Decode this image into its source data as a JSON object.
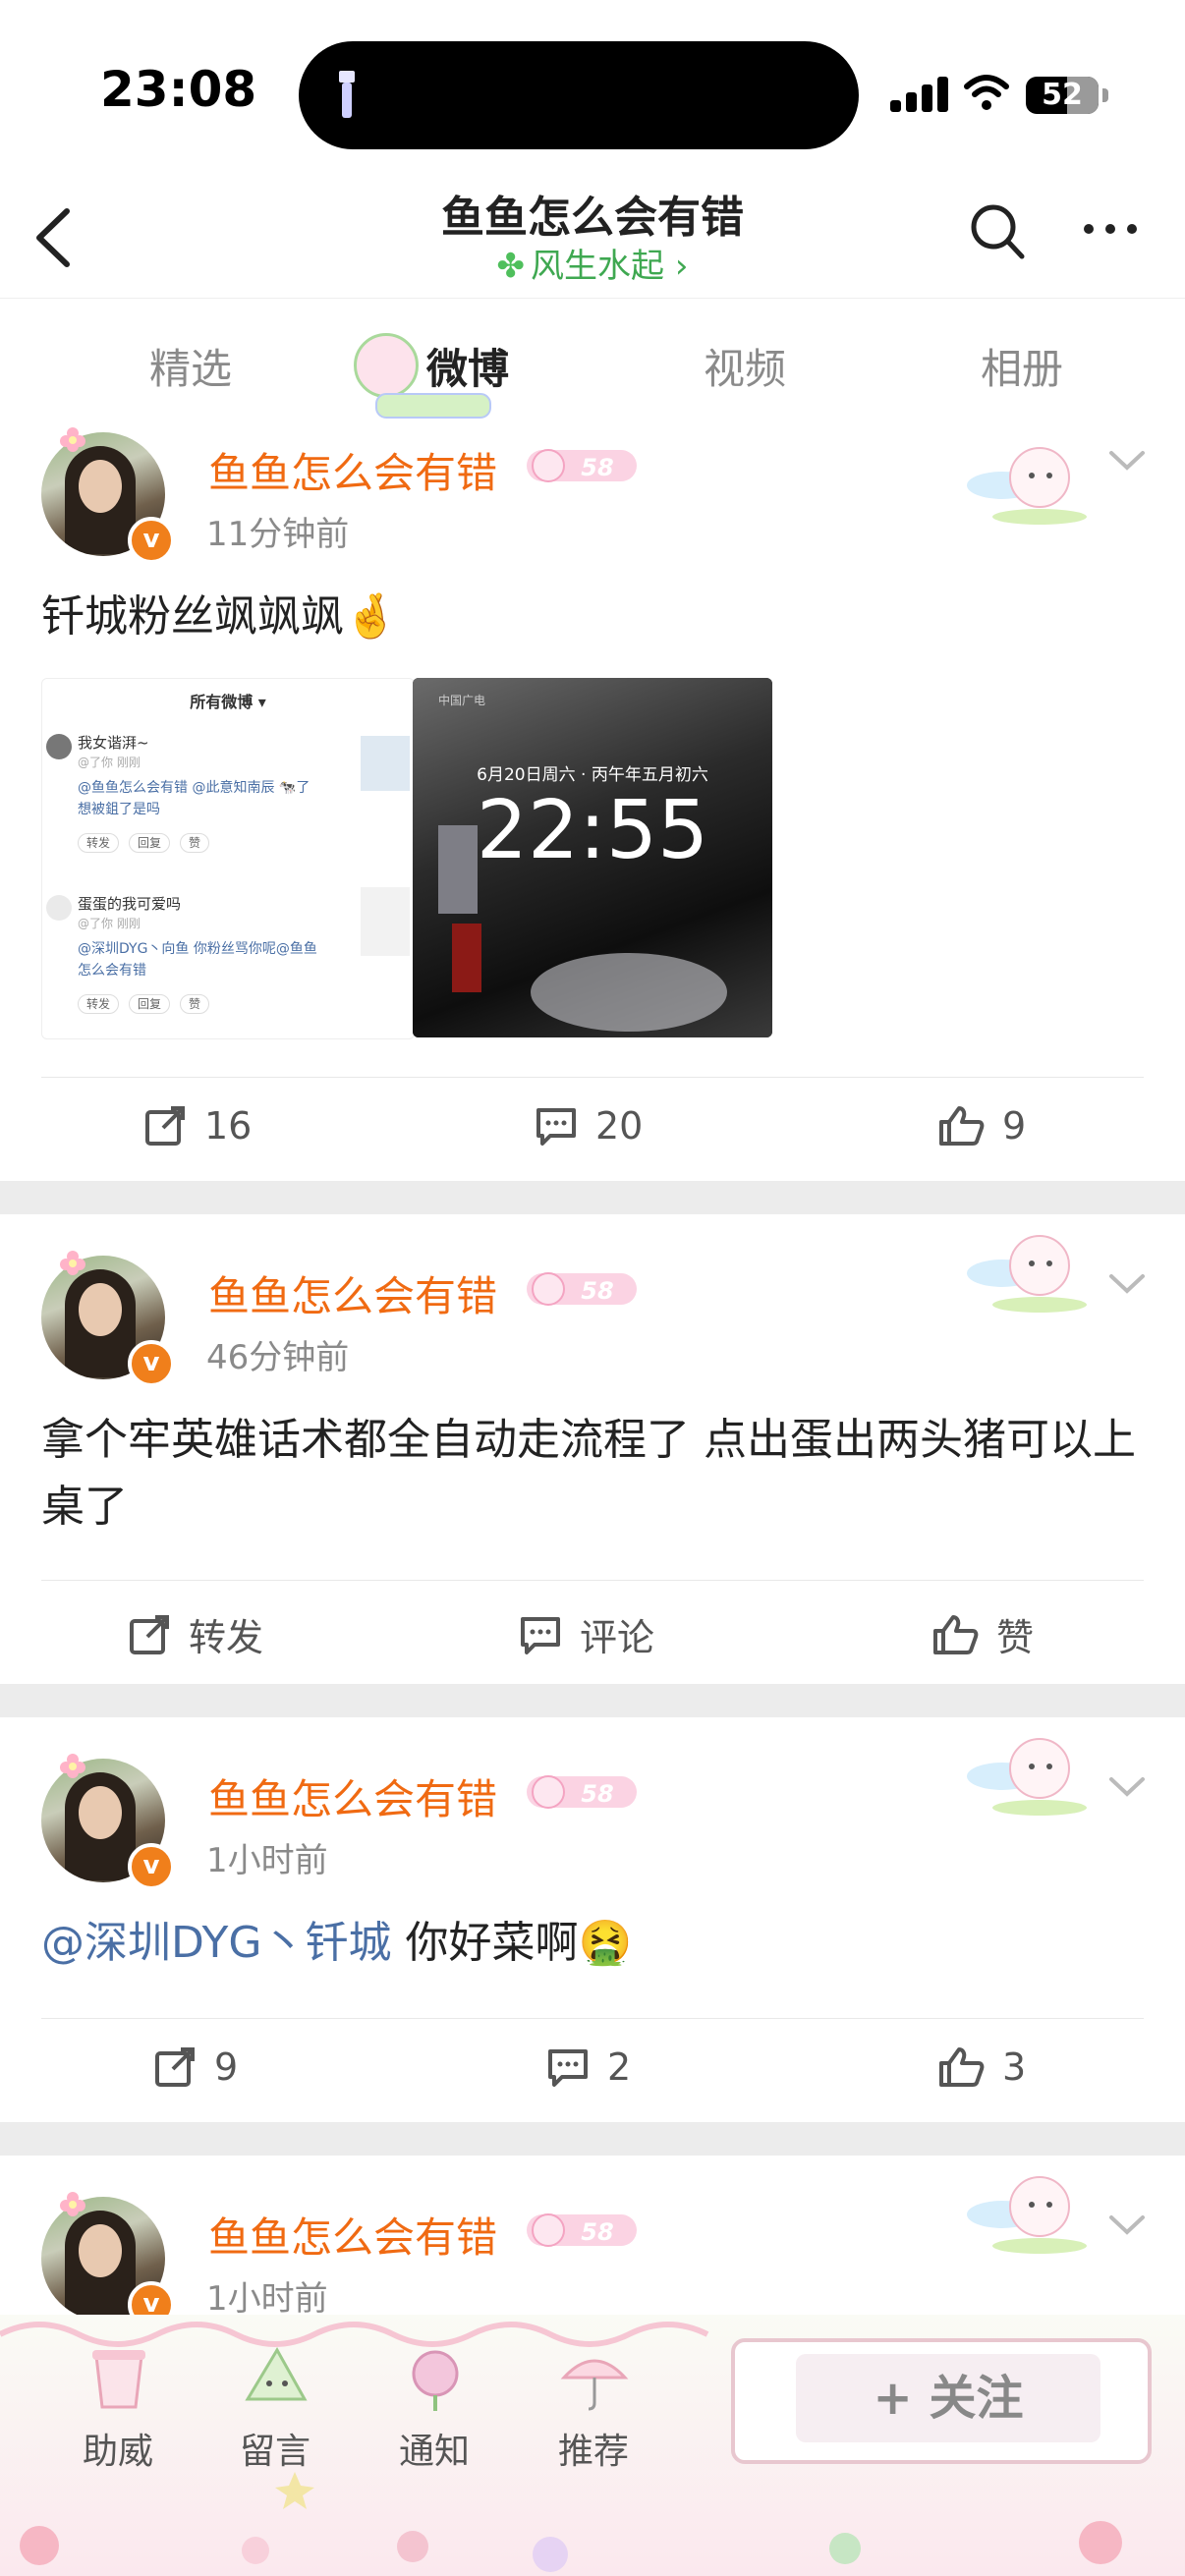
{
  "status_bar": {
    "time": "23:08",
    "battery": "52"
  },
  "header": {
    "title": "鱼鱼怎么会有错",
    "subtitle": "风生水起",
    "subtitle_chevron": "›"
  },
  "tabs": [
    {
      "label": "精选",
      "active": false
    },
    {
      "label": "微博",
      "active": true
    },
    {
      "label": "视频",
      "active": false
    },
    {
      "label": "相册",
      "active": false
    }
  ],
  "posts": [
    {
      "author": "鱼鱼怎么会有错",
      "level": "58",
      "time": "11分钟前",
      "text": "钎城粉丝飒飒飒🤞",
      "actions": {
        "repost": "16",
        "comment": "20",
        "like": "9"
      },
      "images": {
        "left": {
          "header": "所有微博",
          "items": [
            {
              "name": "我女谐湃~",
              "meta": "@了你 刚刚",
              "content": "@鱼鱼怎么会有错 @此意知南辰 🐄了想被鉏了是吗"
            },
            {
              "name": "蛋蛋的我可爱吗",
              "meta": "@了你 刚刚",
              "content": "@深圳DYG丶向鱼 你粉丝骂你呢@鱼鱼怎么会有错"
            }
          ],
          "btns": [
            "转发",
            "回复",
            "赞"
          ]
        },
        "right": {
          "carrier": "中国广电",
          "date": "6月20日周六 · 丙午年五月初六",
          "clock": "22:55"
        }
      }
    },
    {
      "author": "鱼鱼怎么会有错",
      "level": "58",
      "time": "46分钟前",
      "text": "拿个牢英雄话术都全自动走流程了 点出蛋出两头猪可以上桌了",
      "actions": {
        "repost": "转发",
        "comment": "评论",
        "like": "赞"
      }
    },
    {
      "author": "鱼鱼怎么会有错",
      "level": "58",
      "time": "1小时前",
      "mention": "@深圳DYG丶钎城",
      "text": " 你好菜啊🤮",
      "actions": {
        "repost": "9",
        "comment": "2",
        "like": "3"
      }
    },
    {
      "author": "鱼鱼怎么会有错",
      "level": "58",
      "time": "1小时前"
    }
  ],
  "bottom_bar": {
    "items": [
      "助威",
      "留言",
      "通知",
      "推荐"
    ],
    "follow": "+ 关注"
  },
  "colors": {
    "accent": "#f06a12",
    "mention": "#4a6fa5",
    "green": "#3fa851"
  }
}
